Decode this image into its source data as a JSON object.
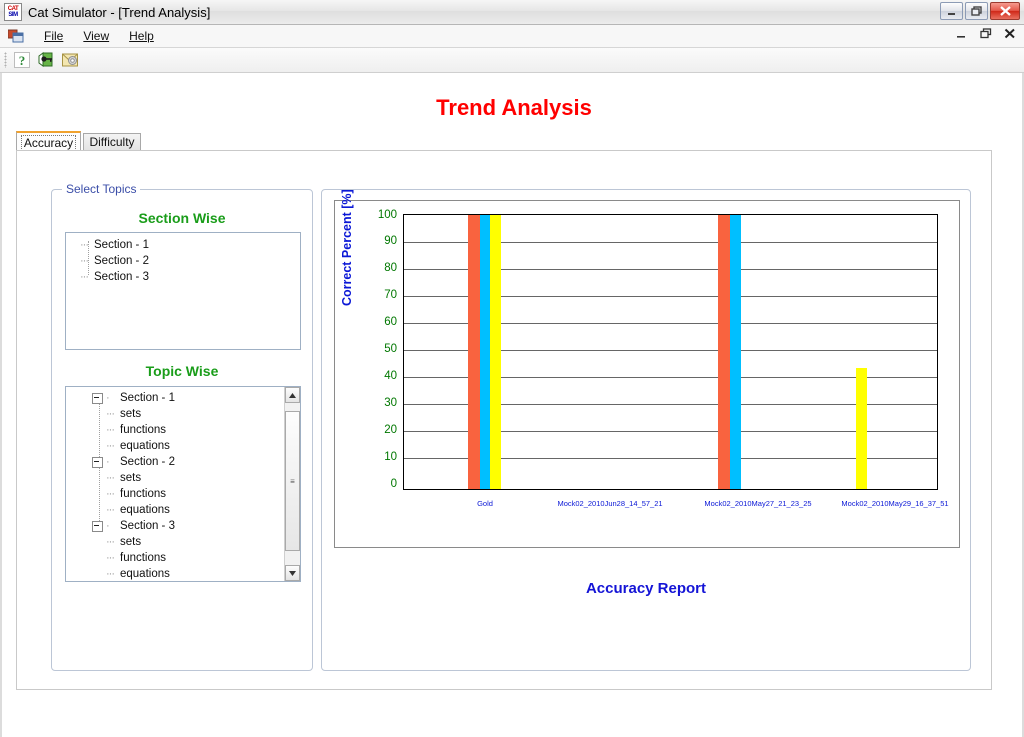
{
  "window": {
    "title": "Cat Simulator - [Trend Analysis]",
    "app_icon": "cat-sim-icon",
    "controls": [
      {
        "name": "minimize-button",
        "glyph": "minimize-icon"
      },
      {
        "name": "maximize-button",
        "glyph": "maximize-icon"
      },
      {
        "name": "close-button",
        "glyph": "close-icon"
      }
    ],
    "mdi_controls": [
      {
        "name": "mdi-minimize-button",
        "glyph": "minimize-icon"
      },
      {
        "name": "mdi-restore-button",
        "glyph": "restore-icon"
      },
      {
        "name": "mdi-close-button",
        "glyph": "close-icon"
      }
    ]
  },
  "menu": {
    "mdi_icon": "mdi-child-icon",
    "items": [
      {
        "label": "File",
        "accesskey": "F"
      },
      {
        "label": "View",
        "accesskey": "V"
      },
      {
        "label": "Help",
        "accesskey": "H"
      }
    ]
  },
  "toolbar": {
    "buttons": [
      {
        "name": "help-question-icon",
        "title": "Help"
      },
      {
        "name": "key-unlock-icon",
        "title": "Key"
      },
      {
        "name": "mail-envelope-icon",
        "title": "Mail"
      }
    ]
  },
  "page": {
    "title": "Trend Analysis"
  },
  "tabs": [
    {
      "label": "Accuracy",
      "active": true
    },
    {
      "label": "Difficulty",
      "active": false
    }
  ],
  "select_topics": {
    "legend": "Select Topics",
    "section_wise": {
      "heading": "Section Wise",
      "items": [
        "Section - 1",
        "Section - 2",
        "Section - 3"
      ]
    },
    "topic_wise": {
      "heading": "Topic Wise",
      "groups": [
        {
          "label": "Section - 1",
          "children": [
            "sets",
            "functions",
            "equations"
          ]
        },
        {
          "label": "Section - 2",
          "children": [
            "sets",
            "functions",
            "equations"
          ]
        },
        {
          "label": "Section - 3",
          "children": [
            "sets",
            "functions",
            "equations"
          ]
        }
      ]
    }
  },
  "report": {
    "caption": "Accuracy Report"
  },
  "chart_data": {
    "type": "bar",
    "title": "",
    "xlabel": "",
    "ylabel": "Correct Percent [%]",
    "ylim": [
      0,
      100
    ],
    "ytick_values": [
      0,
      10,
      20,
      30,
      40,
      50,
      60,
      70,
      80,
      90,
      100
    ],
    "ytick_labels": [
      "0",
      "10",
      "20",
      "30",
      "40",
      "50",
      "60",
      "70",
      "80",
      "90",
      "100"
    ],
    "grid": true,
    "legend": false,
    "legend_position": "none",
    "categories": [
      "Gold",
      "Mock02_2010Jun28_14_57_21",
      "Mock02_2010May27_21_23_25",
      "Mock02_2010May29_16_37_51"
    ],
    "series": [
      {
        "name": "Section - 1",
        "color": "#f9633f",
        "values": [
          100,
          0,
          100,
          0
        ]
      },
      {
        "name": "Section - 2",
        "color": "#00bfff",
        "values": [
          100,
          0,
          100,
          0
        ]
      },
      {
        "name": "Section - 3",
        "color": "#ffff00",
        "values": [
          100,
          0,
          0,
          44
        ]
      }
    ],
    "axis_color": "#000000",
    "ytick_color": "#007700",
    "xtick_color": "#0a17d6",
    "ylabel_color": "#0a17d6"
  }
}
